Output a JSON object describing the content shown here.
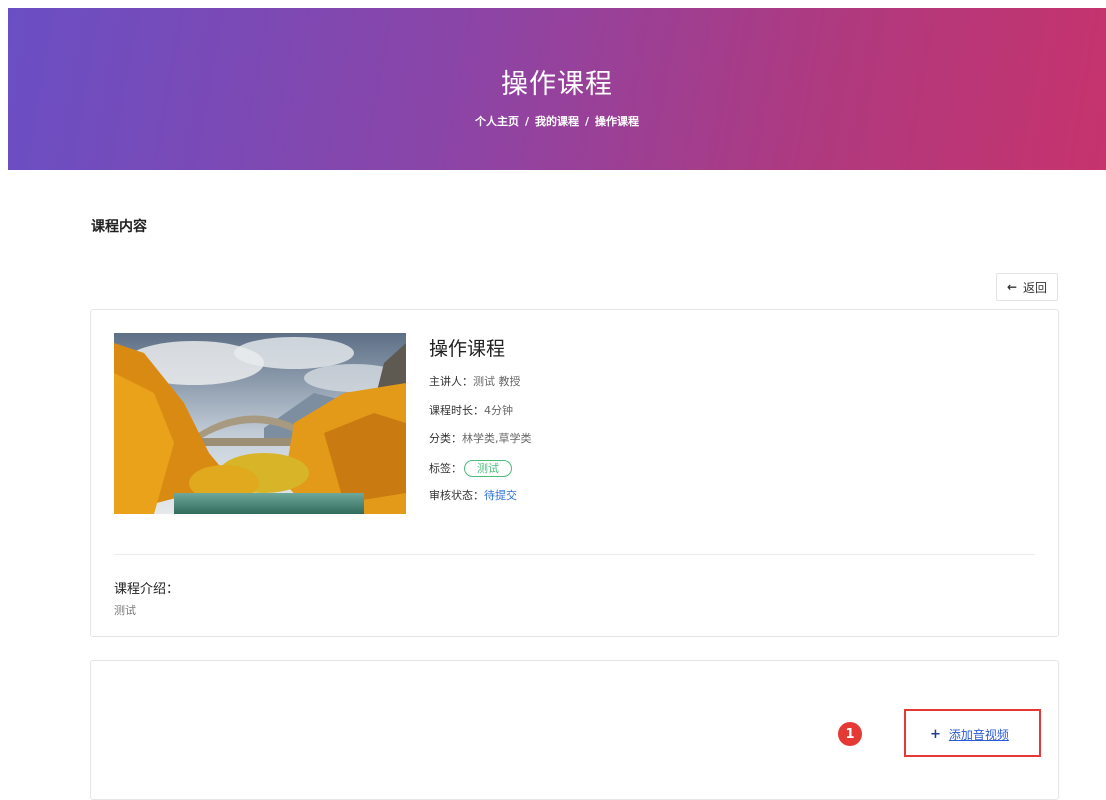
{
  "hero": {
    "title": "操作课程",
    "breadcrumb": [
      "个人主页",
      "我的课程",
      "操作课程"
    ],
    "separator": "/"
  },
  "section_title": "课程内容",
  "back_button": {
    "icon": "arrow-left-icon",
    "label": "返回"
  },
  "course": {
    "thumbnail": "autumn-stone-bridge-image",
    "name": "操作课程",
    "lecturer_label": "主讲人：",
    "lecturer": "测试 教授",
    "duration_label": "课程时长：",
    "duration": "4分钟",
    "category_label": "分类：",
    "category": "林学类,草学类",
    "tags_label": "标签：",
    "tags": [
      "测试"
    ],
    "status_label": "审核状态：",
    "status": "待提交",
    "intro_label": "课程介绍：",
    "intro": "测试"
  },
  "media": {
    "step_number": "1",
    "add_icon": "plus-icon",
    "add_label": "添加音视频"
  },
  "colors": {
    "hero_gradient": [
      "#6a4fc4",
      "#c6336d"
    ],
    "tag": "#4cbb7a",
    "status": "#2a6fd6",
    "highlight": "#e53935",
    "link": "#2a5bd7"
  }
}
